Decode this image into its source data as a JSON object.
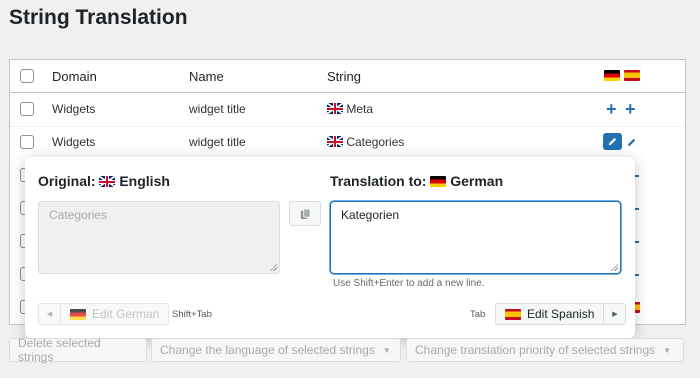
{
  "page": {
    "title": "String Translation"
  },
  "table": {
    "headers": {
      "domain": "Domain",
      "name": "Name",
      "string": "String"
    },
    "rows": [
      {
        "domain": "Widgets",
        "name": "widget title",
        "string": "Meta"
      },
      {
        "domain": "Widgets",
        "name": "widget title",
        "string": "Categories"
      }
    ]
  },
  "popup": {
    "original_label": "Original:",
    "original_language": "English",
    "translation_label": "Translation to:",
    "translation_language": "German",
    "source_text": "Categories",
    "translation_text": "Kategorien",
    "hint": "Use Shift+Enter to add a new line.",
    "prev_button": "Edit German",
    "prev_shortcut": "Shift+Tab",
    "next_shortcut": "Tab",
    "next_button": "Edit Spanish"
  },
  "bulk_actions": {
    "delete": "Delete selected strings",
    "change_language": "Change the language of selected strings",
    "change_priority": "Change translation priority of selected strings"
  },
  "icons": {
    "flag_german": "flag-de",
    "flag_spanish": "flag-es",
    "flag_uk": "flag-uk",
    "add": "plus-icon",
    "edit": "pencil-icon",
    "copy": "copy-icon"
  },
  "colors": {
    "accent": "#2271b1",
    "focus": "#72aee6"
  }
}
